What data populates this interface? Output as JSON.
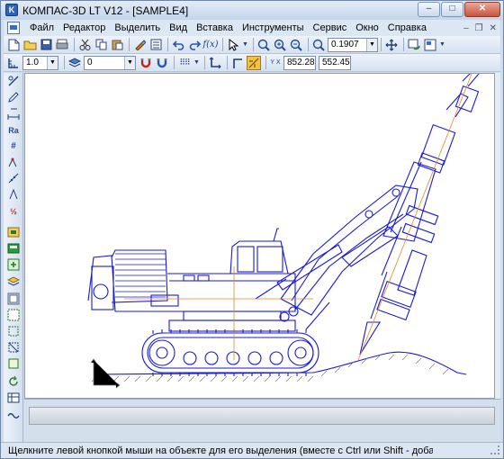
{
  "window": {
    "app_icon_text": "K",
    "title": "КОМПАС-3D LT V12 - [SAMPLE4]",
    "controls": {
      "minimize": "–",
      "maximize": "□",
      "close": "✕"
    }
  },
  "menubar": {
    "items": [
      {
        "label": "Файл"
      },
      {
        "label": "Редактор"
      },
      {
        "label": "Выделить"
      },
      {
        "label": "Вид"
      },
      {
        "label": "Вставка"
      },
      {
        "label": "Инструменты"
      },
      {
        "label": "Сервис"
      },
      {
        "label": "Окно"
      },
      {
        "label": "Справка"
      }
    ],
    "mdi_controls": {
      "minimize": "–",
      "restore": "❐",
      "close": "✕"
    }
  },
  "toolbar_standard": {
    "zoom_value": "0.1907"
  },
  "toolbar_current_state": {
    "step_value": "1.0",
    "layer_value": "0",
    "coord_label": "Y X",
    "coord_x": "852.28",
    "coord_y": "552.45"
  },
  "drawing": {
    "title": "SAMPLE4",
    "line_color": "#1a1ad6",
    "axis_color": "#e0882a"
  },
  "statusbar": {
    "message": "Щелкните левой кнопкой мыши на объекте для его выделения (вместе с Ctrl или Shift - добавить к выделенным)"
  }
}
